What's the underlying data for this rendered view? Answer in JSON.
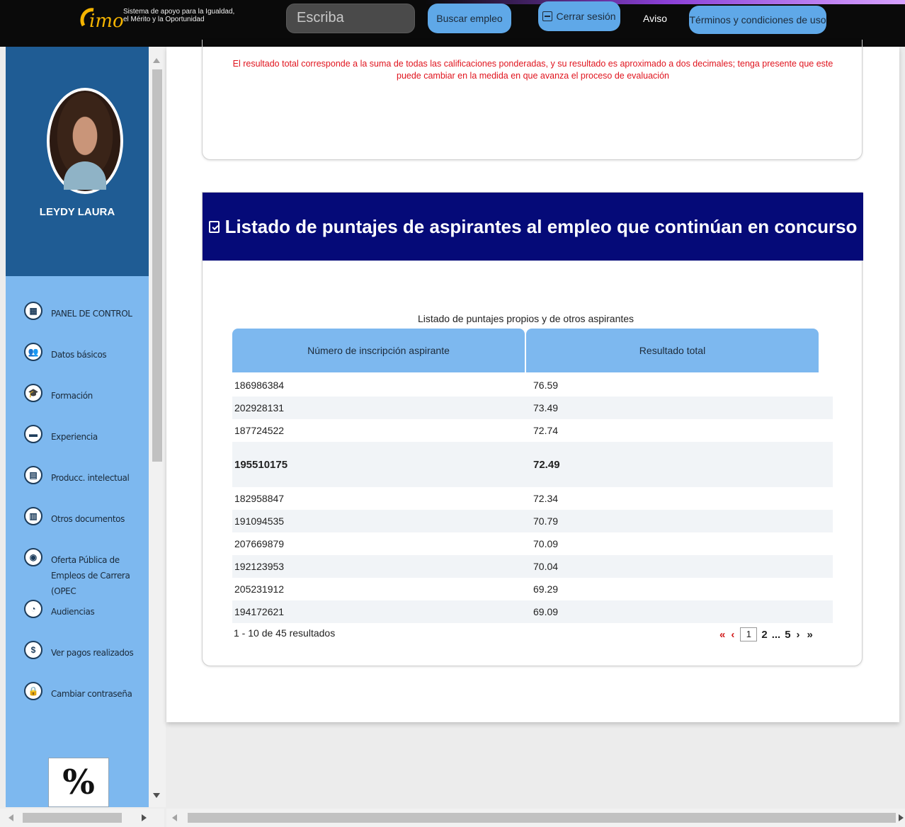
{
  "header": {
    "logo_text_line1": "Sistema de apoyo para la Igualdad,",
    "logo_text_line2": "el Mérito y la Oportunidad",
    "search_placeholder": "Escriba",
    "search_button": "Buscar empleo",
    "logout_button": "Cerrar sesión",
    "notice_link": "Aviso",
    "terms_button": "Términos y condiciones de uso"
  },
  "sidebar": {
    "user_name": "LEYDY LAURA",
    "items": [
      {
        "label": "PANEL DE CONTROL",
        "icon": "dashboard-icon"
      },
      {
        "label": "Datos básicos",
        "icon": "people-icon"
      },
      {
        "label": "Formación",
        "icon": "graduate-icon"
      },
      {
        "label": "Experiencia",
        "icon": "briefcase-icon"
      },
      {
        "label": "Producc. intelectual",
        "icon": "book-icon"
      },
      {
        "label": "Otros documentos",
        "icon": "document-icon"
      },
      {
        "label": "Oferta Pública de",
        "label2": "Empleos de Carrera (OPEC",
        "icon": "globe-icon"
      },
      {
        "label": "Audiencias",
        "icon": "audience-icon"
      },
      {
        "label": "Ver pagos realizados",
        "icon": "dollar-icon"
      },
      {
        "label": "Cambiar contraseña",
        "icon": "lock-icon"
      }
    ]
  },
  "notice": {
    "text": "El resultado total corresponde a la suma de todas las calificaciones ponderadas, y su resultado es aproximado a dos decimales; tenga presente que este puede cambiar en la medida en que avanza el proceso de evaluación"
  },
  "listing": {
    "title": "Listado de puntajes de aspirantes al empleo que continúan en concurso",
    "caption": "Listado de puntajes propios y de otros aspirantes",
    "columns": [
      "Número de inscripción aspirante",
      "Resultado total"
    ],
    "rows": [
      {
        "id": "186986384",
        "score": "76.59"
      },
      {
        "id": "202928131",
        "score": "73.49"
      },
      {
        "id": "187724522",
        "score": "72.74"
      },
      {
        "id": "195510175",
        "score": "72.49"
      },
      {
        "id": "182958847",
        "score": "72.34"
      },
      {
        "id": "191094535",
        "score": "70.79"
      },
      {
        "id": "207669879",
        "score": "70.09"
      },
      {
        "id": "192123953",
        "score": "70.04"
      },
      {
        "id": "205231912",
        "score": "69.29"
      },
      {
        "id": "194172621",
        "score": "69.09"
      }
    ],
    "result_count": "1 - 10 de 45 resultados",
    "pager": {
      "first": "«",
      "prev": "‹",
      "current": "1",
      "page2": "2",
      "ellipsis": "...",
      "last_page": "5",
      "next": "›",
      "last": "»"
    }
  },
  "colors": {
    "topbar": "#0a0a0a",
    "sidebar": "#7db8ef",
    "profile_bg": "#1f5c94",
    "header_band": "#050a78",
    "notice_red": "#e0141e",
    "pill": "#5fa8e8"
  }
}
